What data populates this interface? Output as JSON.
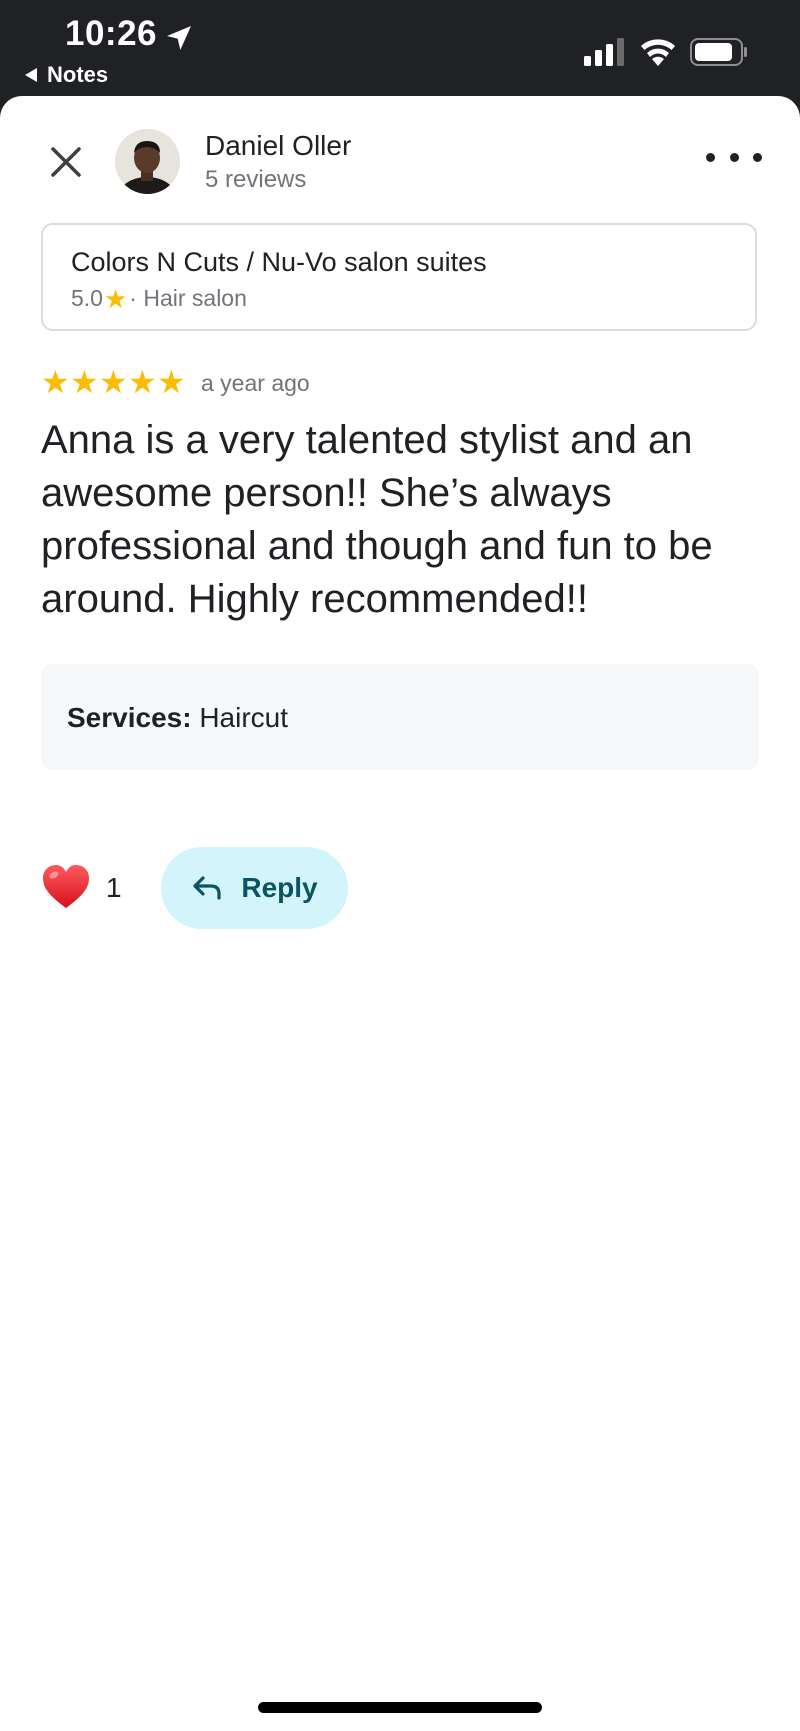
{
  "status_bar": {
    "time": "10:26",
    "back_app": "Notes",
    "icons": [
      "location-arrow-icon",
      "cellular-signal-icon",
      "wifi-icon",
      "battery-icon"
    ]
  },
  "header": {
    "reviewer_name": "Daniel Oller",
    "reviewer_reviews": "5 reviews",
    "close_icon": "close-icon",
    "more_icon": "more-horizontal-icon"
  },
  "place": {
    "name": "Colors N Cuts / Nu-Vo salon suites",
    "rating": "5.0",
    "category": "· Hair salon"
  },
  "review": {
    "star_count": 5,
    "star_glyph": "★",
    "date": "a year ago",
    "text": "Anna is a very talented stylist and an awesome person!! She’s always professional and though and fun to be around. Highly recommended!!",
    "services_label": "Services:",
    "services_value": " Haircut"
  },
  "actions": {
    "like_count": "1",
    "reply_label": "Reply"
  },
  "colors": {
    "star": "#fbbc04",
    "reply_bg": "#d3f4fb",
    "reply_text": "#0b5563",
    "heart": "#e3262e"
  }
}
